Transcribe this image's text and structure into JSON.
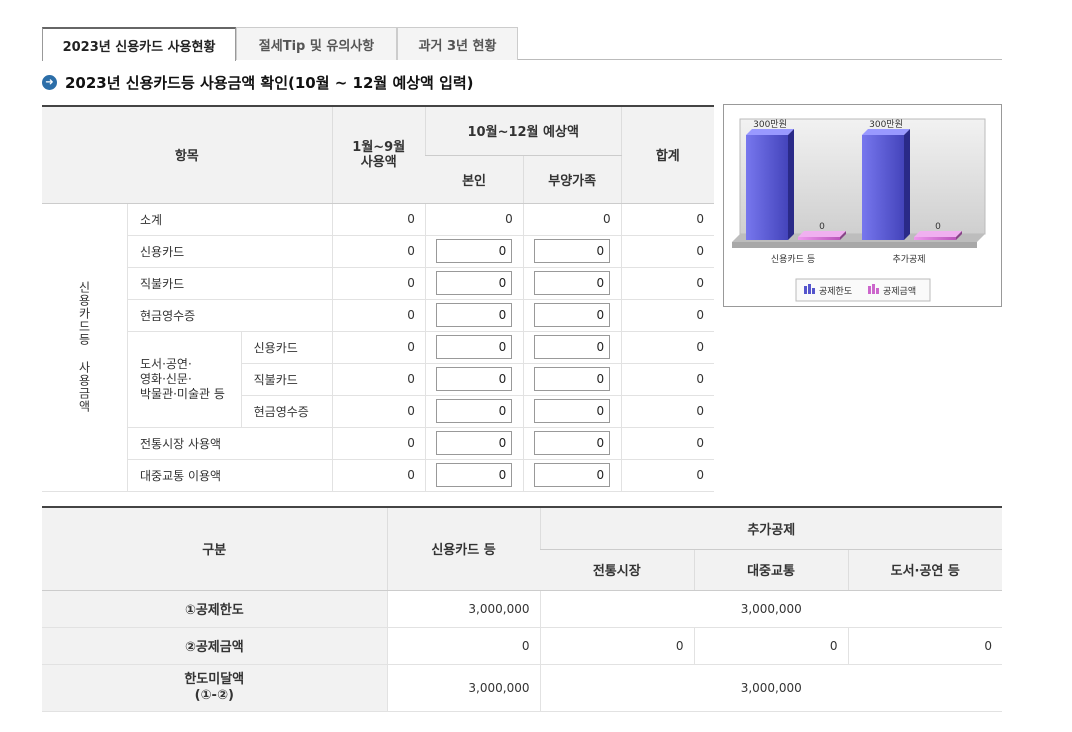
{
  "tabs": [
    {
      "label": "2023년 신용카드 사용현황",
      "active": true
    },
    {
      "label": "절세Tip 및 유의사항",
      "active": false
    },
    {
      "label": "과거 3년 현황",
      "active": false
    }
  ],
  "section_title": "2023년 신용카드등 사용금액 확인(10월 ~ 12월 예상액 입력)",
  "top_table": {
    "headers": {
      "item": "항목",
      "jan_sep": "1월~9월\n사용액",
      "oct_dec": "10월~12월 예상액",
      "self": "본인",
      "dependent": "부양가족",
      "total": "합계"
    },
    "group_label": "신용카드등 사용금액",
    "book_group_label": "도서·공연·\n영화·신문·\n박물관·미술관 등",
    "rows": [
      {
        "label": "소계",
        "jan_sep": "0",
        "self": "0",
        "dependent": "0",
        "total": "0"
      },
      {
        "label": "신용카드",
        "jan_sep": "0",
        "self": "0",
        "dependent": "0",
        "total": "0"
      },
      {
        "label": "직불카드",
        "jan_sep": "0",
        "self": "0",
        "dependent": "0",
        "total": "0"
      },
      {
        "label": "현금영수증",
        "jan_sep": "0",
        "self": "0",
        "dependent": "0",
        "total": "0"
      },
      {
        "label": "신용카드",
        "jan_sep": "0",
        "self": "0",
        "dependent": "0",
        "total": "0"
      },
      {
        "label": "직불카드",
        "jan_sep": "0",
        "self": "0",
        "dependent": "0",
        "total": "0"
      },
      {
        "label": "현금영수증",
        "jan_sep": "0",
        "self": "0",
        "dependent": "0",
        "total": "0"
      },
      {
        "label": "전통시장 사용액",
        "jan_sep": "0",
        "self": "0",
        "dependent": "0",
        "total": "0"
      },
      {
        "label": "대중교통 이용액",
        "jan_sep": "0",
        "self": "0",
        "dependent": "0",
        "total": "0"
      }
    ]
  },
  "chart_data": {
    "type": "bar",
    "categories": [
      "신용카드 등",
      "추가공제"
    ],
    "series": [
      {
        "name": "공제한도",
        "values": [
          3000000,
          3000000
        ],
        "labels": [
          "300만원",
          "300만원"
        ],
        "color": "#5555cc"
      },
      {
        "name": "공제금액",
        "values": [
          0,
          0
        ],
        "labels": [
          "0",
          "0"
        ],
        "color": "#cc66cc"
      }
    ],
    "ylim": [
      0,
      3000000
    ],
    "legend": "bottom"
  },
  "bottom_table": {
    "headers": {
      "category": "구분",
      "credit": "신용카드 등",
      "additional": "추가공제",
      "market": "전통시장",
      "transit": "대중교통",
      "books": "도서·공연 등"
    },
    "rows": [
      {
        "label": "①공제한도",
        "credit": "3,000,000",
        "additional_merged": "3,000,000"
      },
      {
        "label": "②공제금액",
        "credit": "0",
        "market": "0",
        "transit": "0",
        "books": "0"
      },
      {
        "label": "한도미달액\n(①-②)",
        "credit": "3,000,000",
        "additional_merged": "3,000,000"
      }
    ]
  }
}
